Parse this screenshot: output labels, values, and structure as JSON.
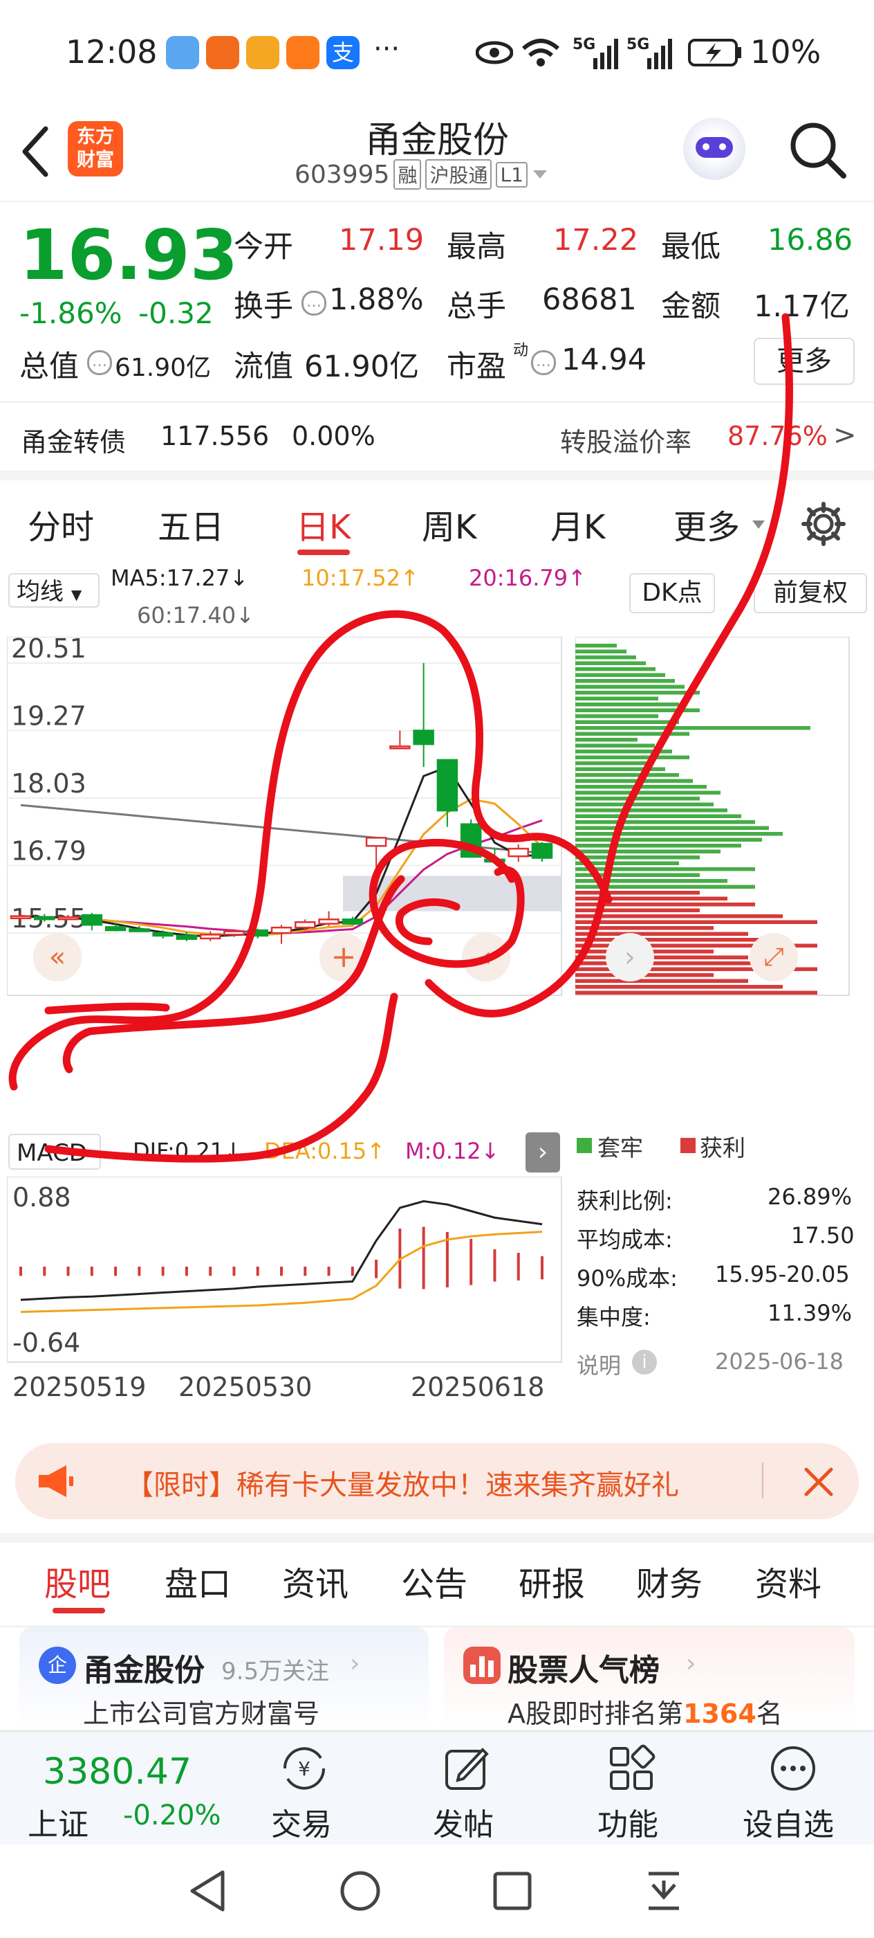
{
  "status_bar": {
    "time": "12:08",
    "signal1": "5G",
    "signal2": "5G",
    "battery": "10%",
    "more": "···"
  },
  "header": {
    "title": "甬金股份",
    "code": "603995",
    "tags": [
      "融",
      "沪股通",
      "L1"
    ],
    "logo_text": [
      "东方",
      "财富"
    ]
  },
  "quote": {
    "price": "16.93",
    "change_pct": "-1.86%",
    "change": "-0.32",
    "open_label": "今开",
    "open": "17.19",
    "high_label": "最高",
    "high": "17.22",
    "low_label": "最低",
    "low": "16.86",
    "turnover_label": "换手",
    "turnover": "1.88%",
    "volume_label": "总手",
    "volume": "68681",
    "amount_label": "金额",
    "amount": "1.17亿",
    "mktcap_label": "总值",
    "mktcap": "61.90亿",
    "float_label": "流值",
    "float": "61.90亿",
    "pe_label": "市盈",
    "pe_sup": "动",
    "pe": "14.94",
    "more_button": "更多",
    "bond_name": "甬金转债",
    "bond_price": "117.556",
    "bond_change": "0.00%",
    "premium_label": "转股溢价率",
    "premium": "87.76%"
  },
  "tabs": [
    "分时",
    "五日",
    "日K",
    "周K",
    "月K",
    "更多"
  ],
  "active_tab": "日K",
  "indicators": {
    "ma_button": "均线",
    "ma5": "MA5:17.27↓",
    "ma10": "10:17.52↑",
    "ma20": "20:16.79↑",
    "ma60": "60:17.40↓",
    "dk_button": "DK点",
    "adjust_button": "前复权"
  },
  "chart_data": {
    "type": "candlestick",
    "y_ticks": [
      "20.51",
      "19.27",
      "18.03",
      "16.79",
      "15.55"
    ],
    "ylim": [
      15.55,
      20.51
    ],
    "x_ticks": [
      "20250519",
      "20250530",
      "20250618"
    ],
    "candles": [
      {
        "o": 15.82,
        "h": 15.92,
        "l": 15.75,
        "c": 15.86
      },
      {
        "o": 15.84,
        "h": 15.9,
        "l": 15.76,
        "c": 15.82
      },
      {
        "o": 15.83,
        "h": 15.88,
        "l": 15.8,
        "c": 15.84
      },
      {
        "o": 15.88,
        "h": 15.92,
        "l": 15.6,
        "c": 15.7
      },
      {
        "o": 15.66,
        "h": 15.72,
        "l": 15.58,
        "c": 15.6
      },
      {
        "o": 15.62,
        "h": 15.68,
        "l": 15.57,
        "c": 15.59
      },
      {
        "o": 15.55,
        "h": 15.6,
        "l": 15.45,
        "c": 15.5
      },
      {
        "o": 15.5,
        "h": 15.57,
        "l": 15.4,
        "c": 15.44
      },
      {
        "o": 15.45,
        "h": 15.58,
        "l": 15.4,
        "c": 15.52
      },
      {
        "o": 15.52,
        "h": 15.62,
        "l": 15.48,
        "c": 15.58
      },
      {
        "o": 15.6,
        "h": 15.63,
        "l": 15.45,
        "c": 15.5
      },
      {
        "o": 15.55,
        "h": 15.7,
        "l": 15.35,
        "c": 15.65
      },
      {
        "o": 15.65,
        "h": 15.8,
        "l": 15.6,
        "c": 15.75
      },
      {
        "o": 15.72,
        "h": 15.95,
        "l": 15.68,
        "c": 15.8
      },
      {
        "o": 15.8,
        "h": 15.85,
        "l": 15.7,
        "c": 15.72
      },
      {
        "o": 17.15,
        "h": 17.3,
        "l": 16.73,
        "c": 17.3
      },
      {
        "o": 18.98,
        "h": 19.27,
        "l": 18.98,
        "c": 18.98
      },
      {
        "o": 19.27,
        "h": 20.51,
        "l": 18.6,
        "c": 19.02
      },
      {
        "o": 18.73,
        "h": 18.73,
        "l": 17.5,
        "c": 17.8
      },
      {
        "o": 17.55,
        "h": 17.64,
        "l": 16.95,
        "c": 16.95
      },
      {
        "o": 16.9,
        "h": 17.1,
        "l": 16.85,
        "c": 16.88
      },
      {
        "o": 16.96,
        "h": 17.18,
        "l": 16.86,
        "c": 17.1
      },
      {
        "o": 17.19,
        "h": 17.22,
        "l": 16.86,
        "c": 16.93
      }
    ],
    "ma_lines": {
      "ma5": "#222",
      "ma10": "#f1a21a",
      "ma20": "#c51b89",
      "ma60": "#777"
    },
    "volume_profile_legend": [
      "套牢",
      "获利"
    ]
  },
  "macd": {
    "label": "MACD",
    "dif": "DIF:0.21↓",
    "dea": "DEA:0.15↑",
    "m": "M:0.12↓",
    "top": "0.88",
    "bottom": "-0.64"
  },
  "chip": {
    "legend_trapped": "套牢",
    "legend_profit": "获利",
    "rows": [
      {
        "k": "获利比例:",
        "v": "26.89%"
      },
      {
        "k": "平均成本:",
        "v": "17.50"
      },
      {
        "k": "90%成本:",
        "v": "15.95-20.05"
      },
      {
        "k": "集中度:",
        "v": "11.39%"
      }
    ],
    "explain": "说明",
    "date": "2025-06-18"
  },
  "promo": {
    "text": "【限时】稀有卡大量发放中！速来集齐赢好礼"
  },
  "category_tabs": [
    "股吧",
    "盘口",
    "资讯",
    "公告",
    "研报",
    "财务",
    "资料"
  ],
  "active_category": "股吧",
  "cards": [
    {
      "title": "甬金股份",
      "extra": "9.5万关注",
      "sub": "上市公司官方财富号"
    },
    {
      "title": "股票人气榜",
      "sub_pre": "A股即时排名第",
      "rank": "1364",
      "sub_post": "名"
    }
  ],
  "bottom_nav": {
    "index_value": "3380.47",
    "index_name": "上证",
    "index_change": "-0.20%",
    "items": [
      "交易",
      "发帖",
      "功能",
      "设自选"
    ]
  },
  "colors": {
    "red": "#e0302f",
    "green": "#0a9e2e",
    "orange": "#f1a21a",
    "brand": "#ff5a1f"
  }
}
